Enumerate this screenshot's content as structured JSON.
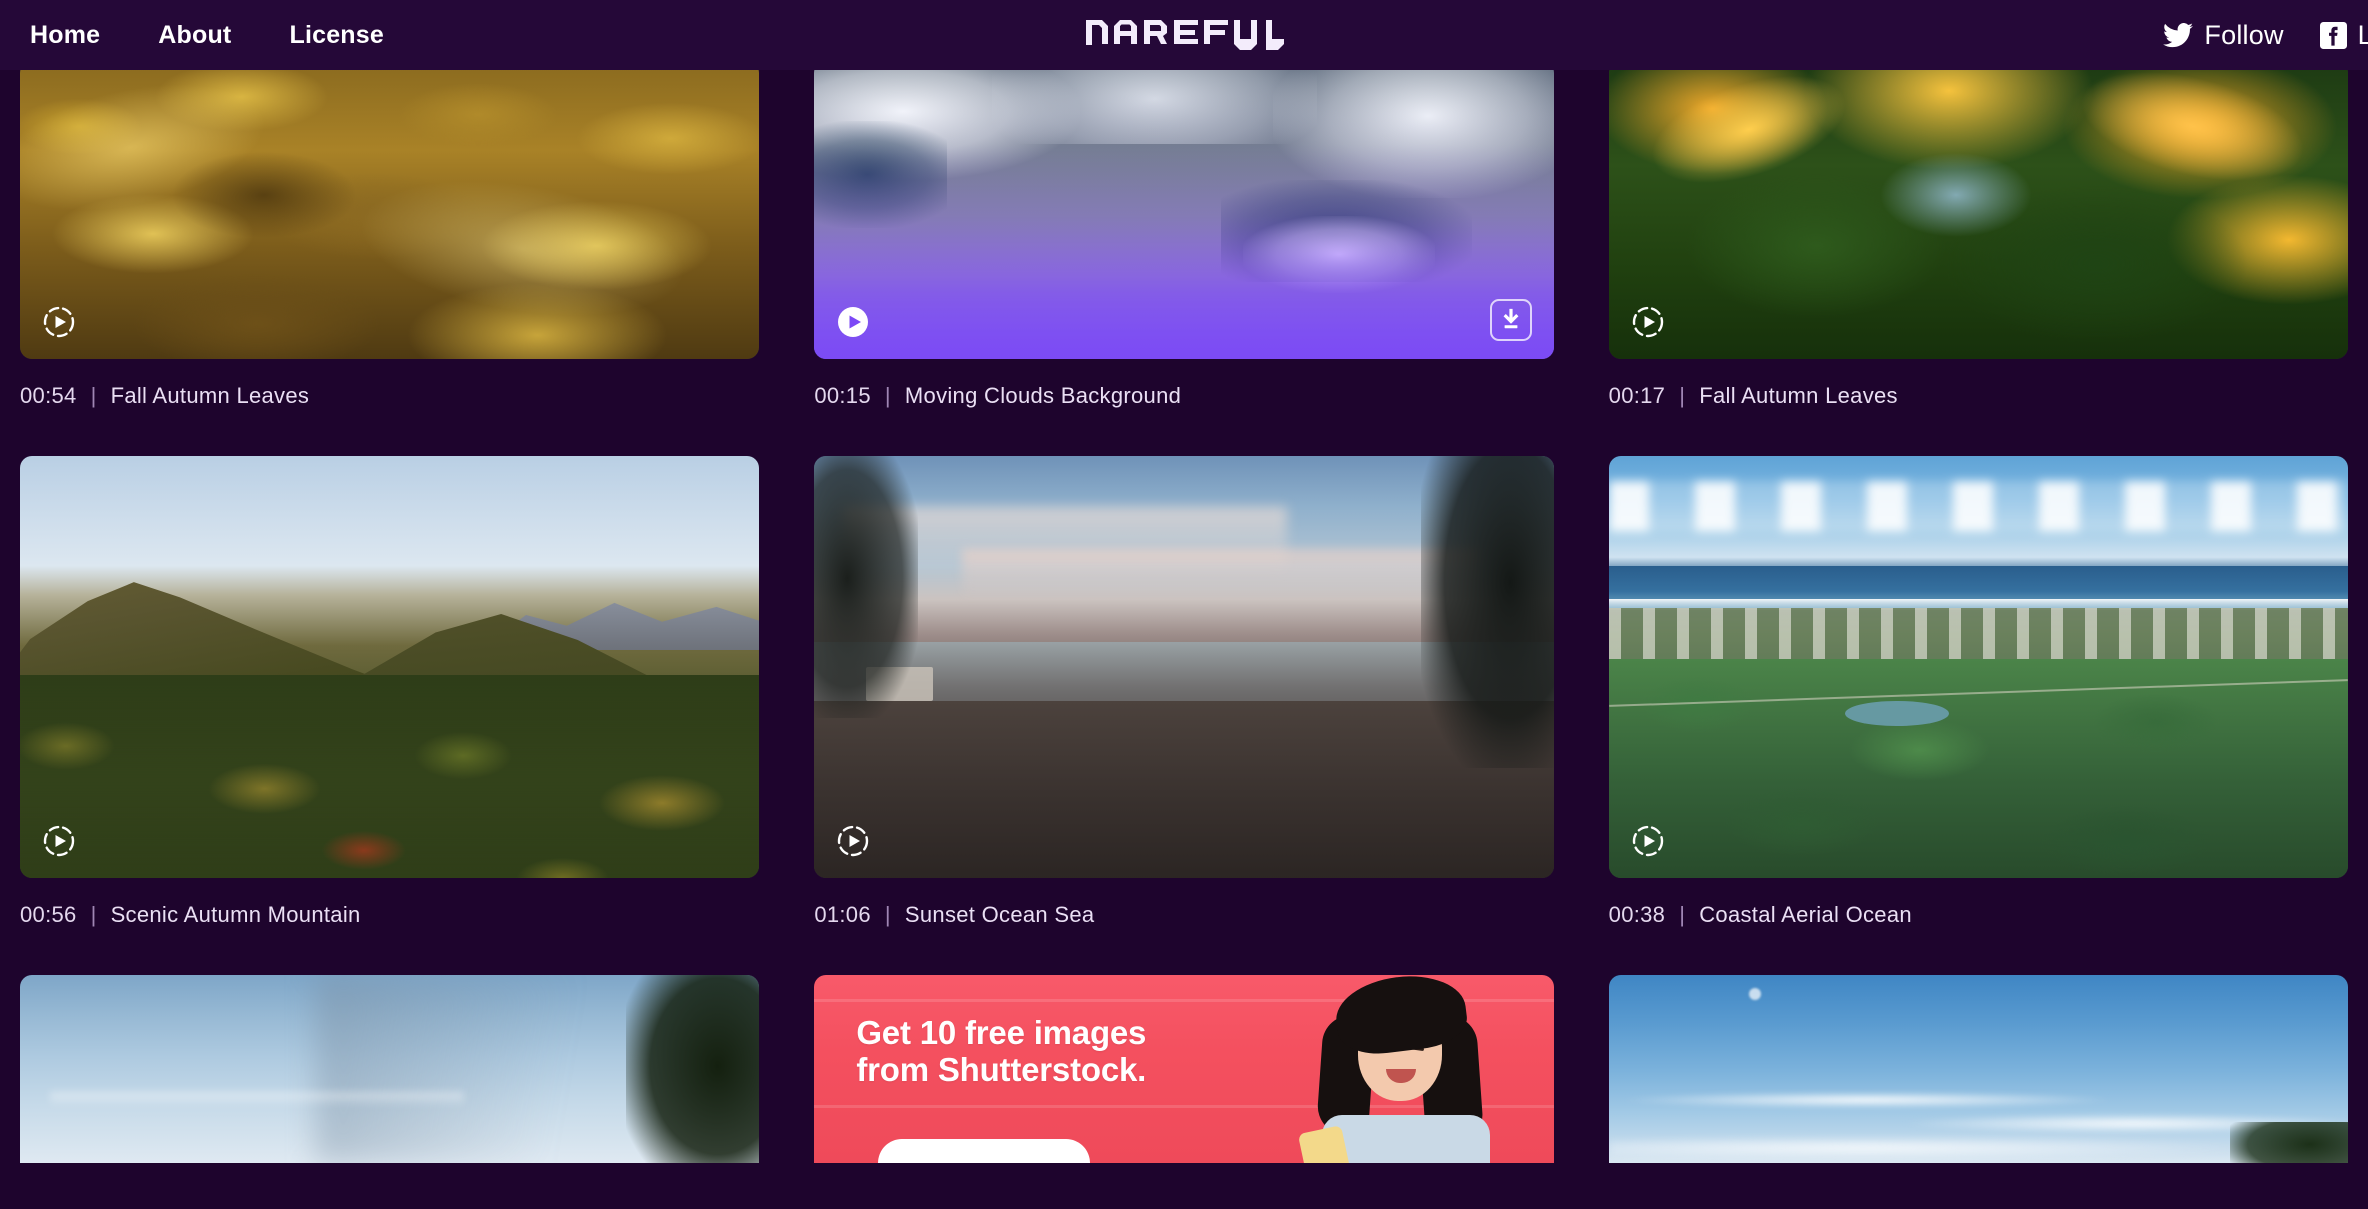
{
  "header": {
    "nav_links": [
      {
        "label": "Home",
        "name": "nav-link-home"
      },
      {
        "label": "About",
        "name": "nav-link-about"
      },
      {
        "label": "License",
        "name": "nav-link-license"
      }
    ],
    "brand": "DAREFUL",
    "social": [
      {
        "label": "Follow",
        "icon": "twitter-icon"
      },
      {
        "label": "Like",
        "icon": "facebook-icon"
      }
    ]
  },
  "theme": {
    "page_background": "#1e042d",
    "header_background": "#250838",
    "accent_purple": "#7c48f6",
    "caption_text": "#e4d8ee",
    "ad_red": "#f4505f"
  },
  "gallery": {
    "row1": [
      {
        "duration": "00:54",
        "separator": "|",
        "title": "Fall Autumn Leaves",
        "hovered": false
      },
      {
        "duration": "00:15",
        "separator": "|",
        "title": "Moving Clouds Background",
        "hovered": true
      },
      {
        "duration": "00:17",
        "separator": "|",
        "title": "Fall Autumn Leaves",
        "hovered": false
      }
    ],
    "row2": [
      {
        "duration": "00:56",
        "separator": "|",
        "title": "Scenic Autumn Mountain",
        "hovered": false
      },
      {
        "duration": "01:06",
        "separator": "|",
        "title": "Sunset Ocean Sea",
        "hovered": false
      },
      {
        "duration": "00:38",
        "separator": "|",
        "title": "Coastal Aerial Ocean",
        "hovered": false
      }
    ]
  },
  "ad": {
    "headline": "Get 10 free images\nfrom Shutterstock.",
    "cta_label": ""
  },
  "icons": {
    "play": "play-icon",
    "download": "download-icon",
    "twitter": "twitter-icon",
    "facebook": "facebook-icon"
  }
}
